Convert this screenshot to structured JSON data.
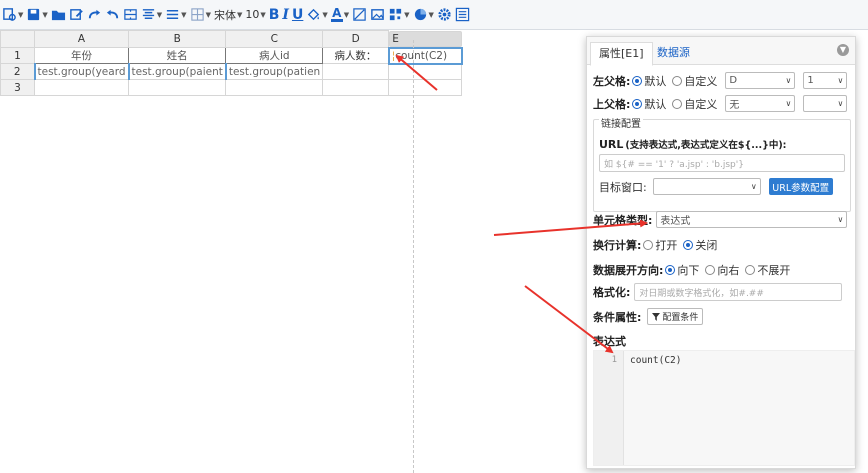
{
  "toolbar": {
    "font_name": "宋体",
    "font_size": "10",
    "bold": "B",
    "italic": "I",
    "underline": "U",
    "font_color_letter": "A"
  },
  "sheet": {
    "columns": [
      "A",
      "B",
      "C",
      "D",
      "E"
    ],
    "rows": [
      "1",
      "2",
      "3"
    ],
    "r1": [
      "年份",
      "姓名",
      "病人id",
      "病人数：",
      "count(C2)"
    ],
    "r2": [
      "test.group(yeard",
      "test.group(paient",
      "test.group(patien"
    ]
  },
  "panel": {
    "tab_props": "属性[E1]",
    "tab_datasource": "数据源",
    "left_parent_label": "左父格:",
    "upper_parent_label": "上父格:",
    "opt_default": "默认",
    "opt_custom": "自定义",
    "left_select1": "D",
    "left_select2": "1",
    "upper_select1": "无",
    "upper_select2": "",
    "link_legend": "链接配置",
    "url_label": "URL",
    "url_hint": "(支持表达式,表达式定义在${...}中):",
    "url_placeholder": "如 ${# == '1' ? 'a.jsp' : 'b.jsp'}",
    "target_label": "目标窗口:",
    "target_value": "",
    "url_param_button": "URL参数配置",
    "cell_type_label": "单元格类型:",
    "cell_type_value": "表达式",
    "wrap_label": "换行计算:",
    "wrap_on": "打开",
    "wrap_off": "关闭",
    "expand_label": "数据展开方向:",
    "expand_down": "向下",
    "expand_right": "向右",
    "expand_none": "不展开",
    "format_label": "格式化:",
    "format_placeholder": "对日期或数字格式化，如#.##",
    "cond_label": "条件属性:",
    "cond_button": "配置条件",
    "expr_label": "表达式",
    "expr_line_no": "1",
    "expr_code": "count(C2)"
  },
  "colors": {
    "accent": "#1a62c6",
    "button": "#2e7cd1",
    "arrow": "#e8322b"
  }
}
